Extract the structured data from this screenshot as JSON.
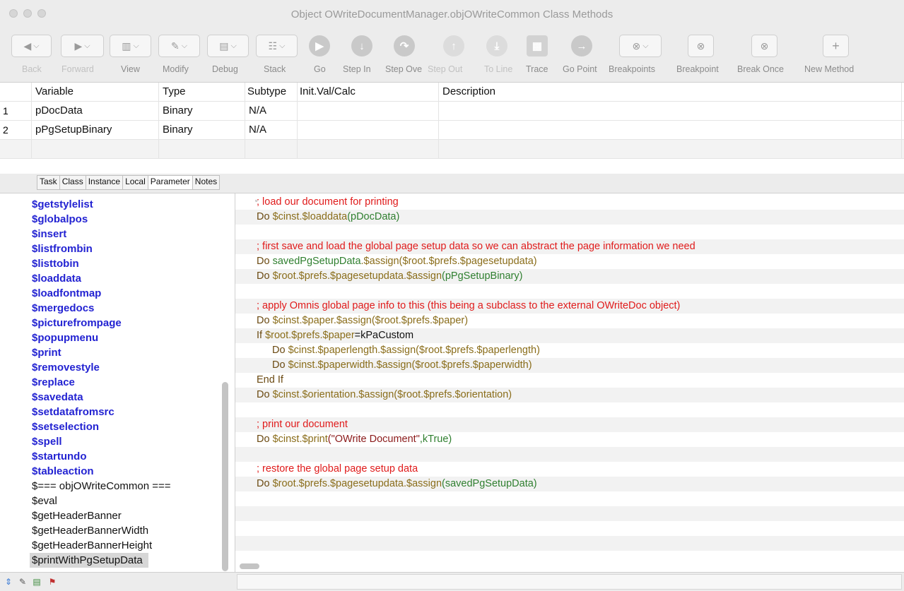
{
  "window": {
    "title": "Object OWriteDocumentManager.objOWriteCommon Class Methods"
  },
  "toolbar": {
    "buttons": [
      {
        "label": "Back",
        "icon": "back-arrow-icon",
        "enabled": false
      },
      {
        "label": "Forward",
        "icon": "forward-arrow-icon",
        "enabled": false
      },
      {
        "label": "View",
        "icon": "view-panel-icon",
        "enabled": true
      },
      {
        "label": "Modify",
        "icon": "modify-icon",
        "enabled": true
      },
      {
        "label": "Debug",
        "icon": "debug-icon",
        "enabled": true
      },
      {
        "label": "Stack",
        "icon": "stack-icon",
        "enabled": true
      },
      {
        "label": "Go",
        "icon": "play-icon",
        "enabled": true
      },
      {
        "label": "Step In",
        "icon": "step-in-icon",
        "enabled": true
      },
      {
        "label": "Step Ove",
        "icon": "step-over-icon",
        "enabled": true
      },
      {
        "label": "Step Out",
        "icon": "step-out-icon",
        "enabled": false
      },
      {
        "label": "To Line",
        "icon": "to-line-icon",
        "enabled": false
      },
      {
        "label": "Trace",
        "icon": "trace-icon",
        "enabled": true
      },
      {
        "label": "Go Point",
        "icon": "go-point-icon",
        "enabled": true
      },
      {
        "label": "Breakpoints",
        "icon": "breakpoints-icon",
        "enabled": true
      },
      {
        "label": "Breakpoint",
        "icon": "breakpoint-icon",
        "enabled": true
      },
      {
        "label": "Break Once",
        "icon": "break-once-icon",
        "enabled": true
      },
      {
        "label": "New Method",
        "icon": "plus-icon",
        "enabled": true
      }
    ]
  },
  "variables": {
    "columns": [
      "Variable",
      "Type",
      "Subtype",
      "Init.Val/Calc",
      "Description"
    ],
    "rows": [
      {
        "num": "1",
        "variable": "pDocData",
        "type": "Binary",
        "subtype": "N/A",
        "init": "",
        "description": ""
      },
      {
        "num": "2",
        "variable": "pPgSetupBinary",
        "type": "Binary",
        "subtype": "N/A",
        "init": "",
        "description": ""
      }
    ],
    "tabs": [
      "Task",
      "Class",
      "Instance",
      "Local",
      "Parameter",
      "Notes"
    ],
    "active_tab": "Parameter"
  },
  "methods": {
    "items": [
      {
        "label": "$getstylelist",
        "style": "blue"
      },
      {
        "label": "$globalpos",
        "style": "blue"
      },
      {
        "label": "$insert",
        "style": "blue"
      },
      {
        "label": "$listfrombin",
        "style": "blue"
      },
      {
        "label": "$listtobin",
        "style": "blue"
      },
      {
        "label": "$loaddata",
        "style": "blue"
      },
      {
        "label": "$loadfontmap",
        "style": "blue"
      },
      {
        "label": "$mergedocs",
        "style": "blue"
      },
      {
        "label": "$picturefrompage",
        "style": "blue"
      },
      {
        "label": "$popupmenu",
        "style": "blue"
      },
      {
        "label": "$print",
        "style": "blue"
      },
      {
        "label": "$removestyle",
        "style": "blue"
      },
      {
        "label": "$replace",
        "style": "blue"
      },
      {
        "label": "$savedata",
        "style": "blue"
      },
      {
        "label": "$setdatafromsrc",
        "style": "blue"
      },
      {
        "label": "$setselection",
        "style": "blue"
      },
      {
        "label": "$spell",
        "style": "blue"
      },
      {
        "label": "$startundo",
        "style": "blue"
      },
      {
        "label": "$tableaction",
        "style": "blue"
      },
      {
        "label": "$=== objOWriteCommon ===",
        "style": "black"
      },
      {
        "label": "$eval",
        "style": "black"
      },
      {
        "label": "$getHeaderBanner",
        "style": "black"
      },
      {
        "label": "$getHeaderBannerWidth",
        "style": "black"
      },
      {
        "label": "$getHeaderBannerHeight",
        "style": "black"
      },
      {
        "label": "$printWithPgSetupData",
        "style": "black",
        "selected": true
      }
    ]
  },
  "code": {
    "lines": [
      {
        "indent": 0,
        "parts": [
          {
            "t": "; load our document for printing",
            "c": "cm"
          }
        ]
      },
      {
        "indent": 0,
        "parts": [
          {
            "t": "Do ",
            "c": "kw"
          },
          {
            "t": "$cinst.$loaddata",
            "c": "nm"
          },
          {
            "t": "(pDocData)",
            "c": "vr"
          }
        ]
      },
      {
        "indent": 0,
        "parts": []
      },
      {
        "indent": 0,
        "parts": [
          {
            "t": "; first save and load the global page setup data so we can abstract the page information we need",
            "c": "cm"
          }
        ]
      },
      {
        "indent": 0,
        "parts": [
          {
            "t": "Do ",
            "c": "kw"
          },
          {
            "t": "savedPgSetupData",
            "c": "vr"
          },
          {
            "t": ".$assign(",
            "c": "nm"
          },
          {
            "t": "$root.$prefs.$pagesetupdata",
            "c": "nm"
          },
          {
            "t": ")",
            "c": "nm"
          }
        ]
      },
      {
        "indent": 0,
        "parts": [
          {
            "t": "Do ",
            "c": "kw"
          },
          {
            "t": "$root.$prefs.$pagesetupdata.$assign",
            "c": "nm"
          },
          {
            "t": "(pPgSetupBinary)",
            "c": "vr"
          }
        ]
      },
      {
        "indent": 0,
        "parts": []
      },
      {
        "indent": 0,
        "parts": [
          {
            "t": "; apply Omnis global page info to this (this being a subclass to the external OWriteDoc object)",
            "c": "cm"
          }
        ]
      },
      {
        "indent": 0,
        "parts": [
          {
            "t": "Do ",
            "c": "kw"
          },
          {
            "t": "$cinst.$paper.$assign(",
            "c": "nm"
          },
          {
            "t": "$root.$prefs.$paper",
            "c": "nm"
          },
          {
            "t": ")",
            "c": "nm"
          }
        ]
      },
      {
        "indent": 0,
        "parts": [
          {
            "t": "If ",
            "c": "kw"
          },
          {
            "t": "$root.$prefs.$paper",
            "c": "nm"
          },
          {
            "t": "=kPaCustom",
            "c": "bk"
          }
        ]
      },
      {
        "indent": 1,
        "parts": [
          {
            "t": "Do ",
            "c": "kw"
          },
          {
            "t": "$cinst.$paperlength.$assign(",
            "c": "nm"
          },
          {
            "t": "$root.$prefs.$paperlength",
            "c": "nm"
          },
          {
            "t": ")",
            "c": "nm"
          }
        ]
      },
      {
        "indent": 1,
        "parts": [
          {
            "t": "Do ",
            "c": "kw"
          },
          {
            "t": "$cinst.$paperwidth.$assign(",
            "c": "nm"
          },
          {
            "t": "$root.$prefs.$paperwidth",
            "c": "nm"
          },
          {
            "t": ")",
            "c": "nm"
          }
        ]
      },
      {
        "indent": 0,
        "parts": [
          {
            "t": "End If",
            "c": "kw"
          }
        ]
      },
      {
        "indent": 0,
        "parts": [
          {
            "t": "Do ",
            "c": "kw"
          },
          {
            "t": "$cinst.$orientation.$assign(",
            "c": "nm"
          },
          {
            "t": "$root.$prefs.$orientation",
            "c": "nm"
          },
          {
            "t": ")",
            "c": "nm"
          }
        ]
      },
      {
        "indent": 0,
        "parts": []
      },
      {
        "indent": 0,
        "parts": [
          {
            "t": "; print our document",
            "c": "cm"
          }
        ]
      },
      {
        "indent": 0,
        "parts": [
          {
            "t": "Do ",
            "c": "kw"
          },
          {
            "t": "$cinst.$print",
            "c": "nm"
          },
          {
            "t": "(\"OWrite Document\"",
            "c": "st"
          },
          {
            "t": ",kTrue)",
            "c": "vr"
          }
        ]
      },
      {
        "indent": 0,
        "parts": []
      },
      {
        "indent": 0,
        "parts": [
          {
            "t": "; restore the global page setup data",
            "c": "cm"
          }
        ]
      },
      {
        "indent": 0,
        "parts": [
          {
            "t": "Do ",
            "c": "kw"
          },
          {
            "t": "$root.$prefs.$pagesetupdata.$assign",
            "c": "nm"
          },
          {
            "t": "(savedPgSetupData)",
            "c": "vr"
          }
        ]
      }
    ]
  },
  "bottombar": {
    "icons": [
      "sort-arrows-icon",
      "modify-icon",
      "debug-icon",
      "breakpoint-flag-icon"
    ]
  },
  "colors": {
    "comment": "#e01b1b",
    "keyword": "#6b4a12",
    "notation": "#8a6d1a",
    "variable": "#2f7f2f",
    "string": "#8b1a1a",
    "method_blue": "#2323d2"
  }
}
